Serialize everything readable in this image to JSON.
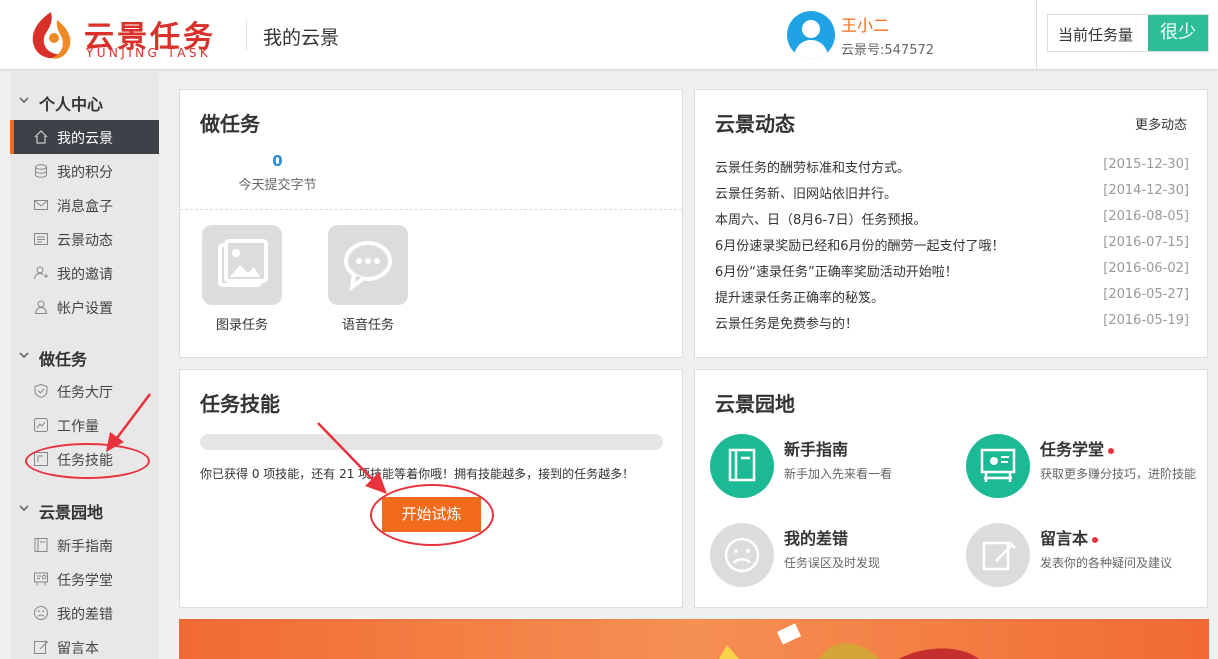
{
  "header": {
    "logo_cn": "云景任务",
    "logo_en": "YUNJING TASK",
    "page_title": "我的云景",
    "user_name": "王小二",
    "user_id": "云景号:547572",
    "task_label": "当前任务量",
    "task_level": "很少"
  },
  "sidebar": {
    "sections": [
      {
        "label": "个人中心",
        "items": [
          {
            "label": "我的云景",
            "icon": "home-icon",
            "active": true
          },
          {
            "label": "我的积分",
            "icon": "coins-icon"
          },
          {
            "label": "消息盒子",
            "icon": "mail-icon"
          },
          {
            "label": "云景动态",
            "icon": "news-icon"
          },
          {
            "label": "我的邀请",
            "icon": "invite-icon"
          },
          {
            "label": "帐户设置",
            "icon": "user-icon"
          }
        ]
      },
      {
        "label": "做任务",
        "items": [
          {
            "label": "任务大厅",
            "icon": "shield-icon"
          },
          {
            "label": "工作量",
            "icon": "chart-icon"
          },
          {
            "label": "任务技能",
            "icon": "skill-icon"
          }
        ]
      },
      {
        "label": "云景园地",
        "items": [
          {
            "label": "新手指南",
            "icon": "book-icon"
          },
          {
            "label": "任务学堂",
            "icon": "board-icon"
          },
          {
            "label": "我的差错",
            "icon": "sad-face-icon"
          },
          {
            "label": "留言本",
            "icon": "edit-icon"
          }
        ]
      }
    ]
  },
  "do_task": {
    "title": "做任务",
    "stat_value": "0",
    "stat_label": "今天提交字节",
    "tiles": [
      {
        "label": "图录任务",
        "icon": "image-icon"
      },
      {
        "label": "语音任务",
        "icon": "chat-icon"
      }
    ]
  },
  "news": {
    "title": "云景动态",
    "more": "更多动态",
    "items": [
      {
        "text": "云景任务的酬劳标准和支付方式。",
        "date": "[2015-12-30]"
      },
      {
        "text": "云景任务新、旧网站依旧并行。",
        "date": "[2014-12-30]"
      },
      {
        "text": "本周六、日（8月6-7日）任务预报。",
        "date": "[2016-08-05]"
      },
      {
        "text": "6月份速录奖励已经和6月份的酬劳一起支付了哦！",
        "date": "[2016-07-15]"
      },
      {
        "text": "6月份“速录任务”正确率奖励活动开始啦！",
        "date": "[2016-06-02]"
      },
      {
        "text": "提升速录任务正确率的秘笈。",
        "date": "[2016-05-27]"
      },
      {
        "text": "云景任务是免费参与的！",
        "date": "[2016-05-19]"
      }
    ]
  },
  "skills": {
    "title": "任务技能",
    "desc": "你已获得 0 项技能，还有 21 项技能等着你哦！拥有技能越多，接到的任务越多！",
    "button": "开始试炼",
    "progress": 0
  },
  "garden": {
    "title": "云景园地",
    "items": [
      {
        "title": "新手指南",
        "desc": "新手加入先来看一看",
        "icon": "book-icon",
        "color": "#1cba94",
        "dot": false
      },
      {
        "title": "任务学堂",
        "desc": "获取更多赚分技巧，进阶技能",
        "icon": "board-icon",
        "color": "#1cba94",
        "dot": true
      },
      {
        "title": "我的差错",
        "desc": "任务误区及时发现",
        "icon": "sad-face-icon",
        "color": "#dcdcdc",
        "dot": false
      },
      {
        "title": "留言本",
        "desc": "发表你的各种疑问及建议",
        "icon": "edit-icon",
        "color": "#dcdcdc",
        "dot": true
      }
    ]
  },
  "colors": {
    "accent": "#f26b1d",
    "brand_red": "#d9312a",
    "teal": "#2dbd98",
    "blue": "#1fa3e4"
  }
}
